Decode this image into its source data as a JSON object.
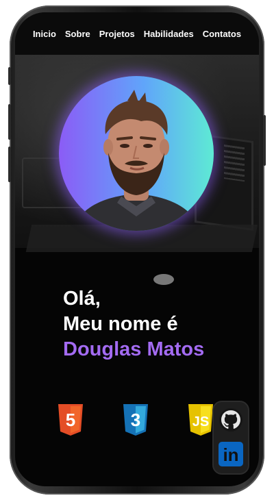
{
  "nav": {
    "items": [
      {
        "label": "Inicio"
      },
      {
        "label": "Sobre"
      },
      {
        "label": "Projetos"
      },
      {
        "label": "Habilidades"
      },
      {
        "label": "Contatos"
      }
    ]
  },
  "hero": {
    "greeting_line1": "Olá,",
    "greeting_line2": "Meu nome é",
    "name": "Douglas Matos",
    "accent_color": "#a36bf2",
    "avatar_gradient": [
      "#8b5cf6",
      "#60a5fa",
      "#5eead4"
    ]
  },
  "tech": [
    {
      "icon": "html5-icon",
      "label": "5",
      "color": "#e44d26"
    },
    {
      "icon": "css3-icon",
      "label": "3",
      "color": "#1572b6"
    },
    {
      "icon": "javascript-icon",
      "label": "JS",
      "color": "#f0db4f"
    }
  ],
  "social": [
    {
      "icon": "github-icon"
    },
    {
      "icon": "linkedin-icon",
      "label": "in",
      "color": "#0a66c2"
    }
  ]
}
